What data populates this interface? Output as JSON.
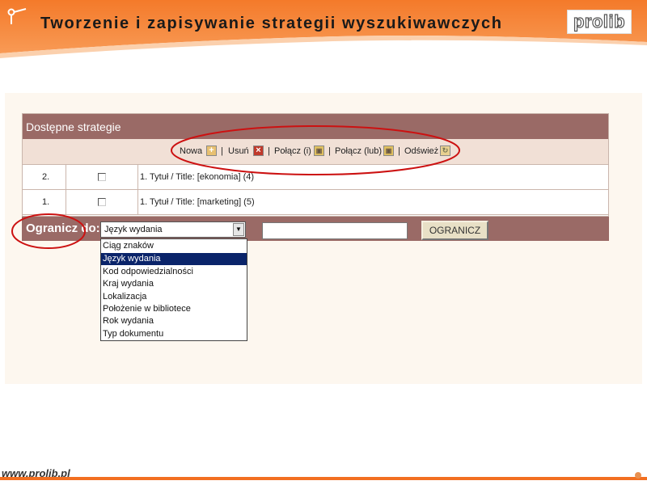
{
  "slide": {
    "title": "Tworzenie i zapisywanie strategii wyszukiwawczych",
    "logo_text": "prolib",
    "footer_url": "www.prolib.pl"
  },
  "strategies": {
    "header_title": "Dostępne strategie",
    "toolbar": {
      "new_label": "Nowa",
      "sep1": "|",
      "delete_label": "Usuń",
      "sep2": "|",
      "merge_and_label": "Połącz (i)",
      "sep3": "|",
      "merge_or_label": "Połącz (lub)",
      "sep4": "|",
      "refresh_label": "Odśwież"
    },
    "rows": [
      {
        "num": "2.",
        "text": "1. Tytuł / Title: [ekonomia] (4)"
      },
      {
        "num": "1.",
        "text": "1. Tytuł / Title: [marketing] (5)"
      }
    ]
  },
  "limit": {
    "label": "Ogranicz do:",
    "selected": "Język wydania",
    "arrow": "▼",
    "input_value": "",
    "button_label": "OGRANICZ",
    "options": [
      "Ciąg znaków",
      "Język wydania",
      "Kod odpowiedzialności",
      "Kraj wydania",
      "Lokalizacja",
      "Położenie w bibliotece",
      "Rok wydania",
      "Typ dokumentu"
    ],
    "selected_option_index": 1
  },
  "colors": {
    "header_orange": "#f26f21",
    "panel_header": "#9a6a66",
    "toolbar_bg": "#f1e0d6",
    "annotation_red": "#cc1111",
    "selection_blue": "#0a246a"
  },
  "icons": {
    "new": "plus-icon",
    "delete": "x-icon",
    "merge_and": "merge-icon",
    "merge_or": "merge-icon",
    "refresh": "refresh-icon",
    "header": "pin-icon"
  }
}
